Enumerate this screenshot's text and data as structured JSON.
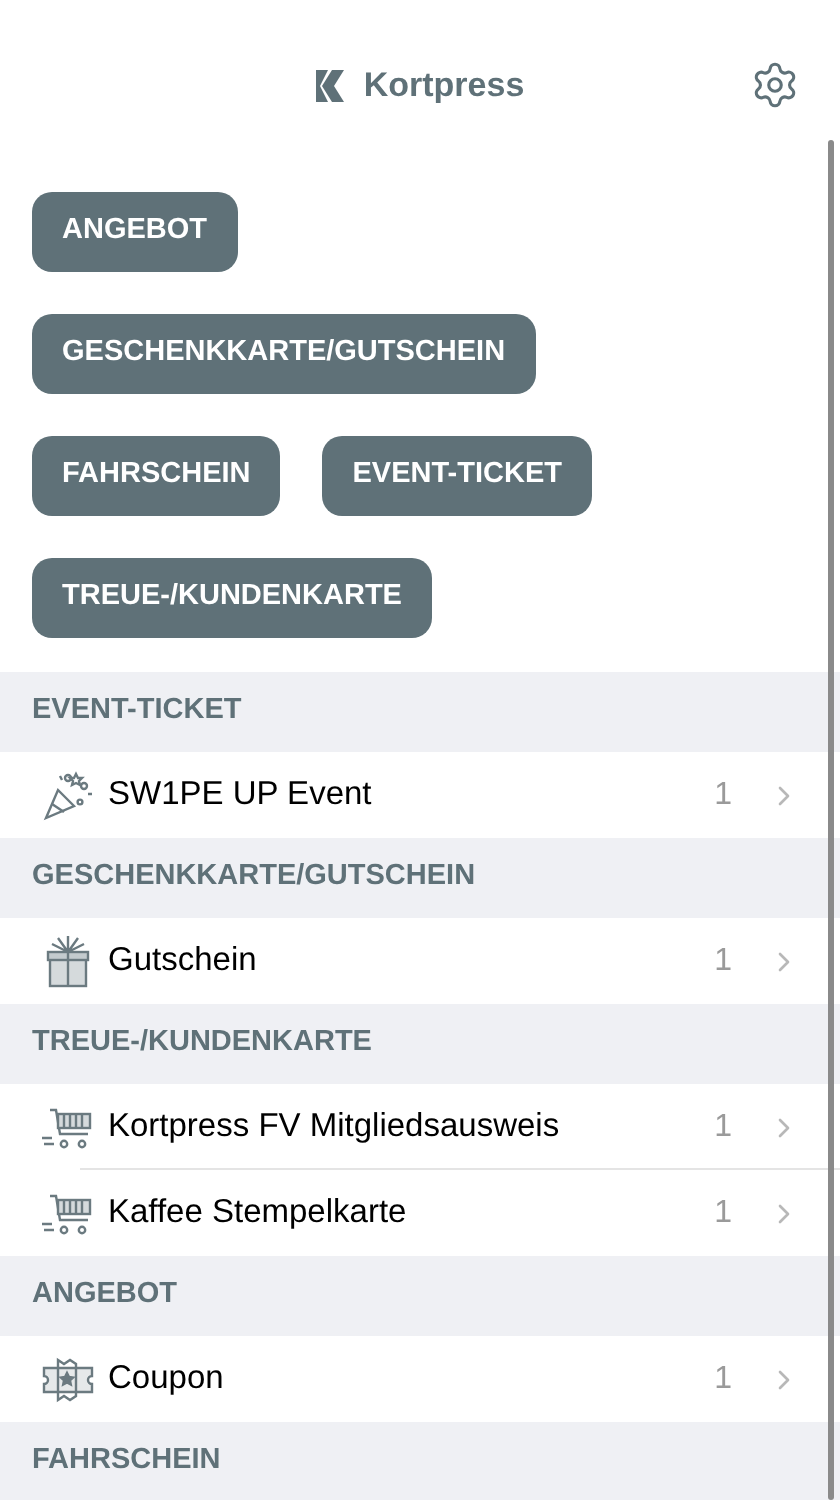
{
  "header": {
    "title": "Kortpress"
  },
  "filters": [
    {
      "label": "ANGEBOT"
    },
    {
      "label": "GESCHENKKARTE/GUTSCHEIN"
    },
    {
      "label": "FAHRSCHEIN"
    },
    {
      "label": "EVENT-TICKET"
    },
    {
      "label": "TREUE-/KUNDENKARTE"
    }
  ],
  "sections": [
    {
      "title": "EVENT-TICKET",
      "items": [
        {
          "kind": "party",
          "name": "SW1PE UP Event",
          "count": "1"
        }
      ]
    },
    {
      "title": "GESCHENKKARTE/GUTSCHEIN",
      "items": [
        {
          "kind": "gift",
          "name": "Gutschein",
          "count": "1"
        }
      ]
    },
    {
      "title": "TREUE-/KUNDENKARTE",
      "items": [
        {
          "kind": "cart",
          "name": "Kortpress FV Mitgliedsausweis",
          "count": "1"
        },
        {
          "kind": "cart",
          "name": "Kaffee Stempelkarte",
          "count": "1"
        }
      ]
    },
    {
      "title": "ANGEBOT",
      "items": [
        {
          "kind": "coupon",
          "name": "Coupon",
          "count": "1"
        }
      ]
    },
    {
      "title": "FAHRSCHEIN"
    }
  ]
}
